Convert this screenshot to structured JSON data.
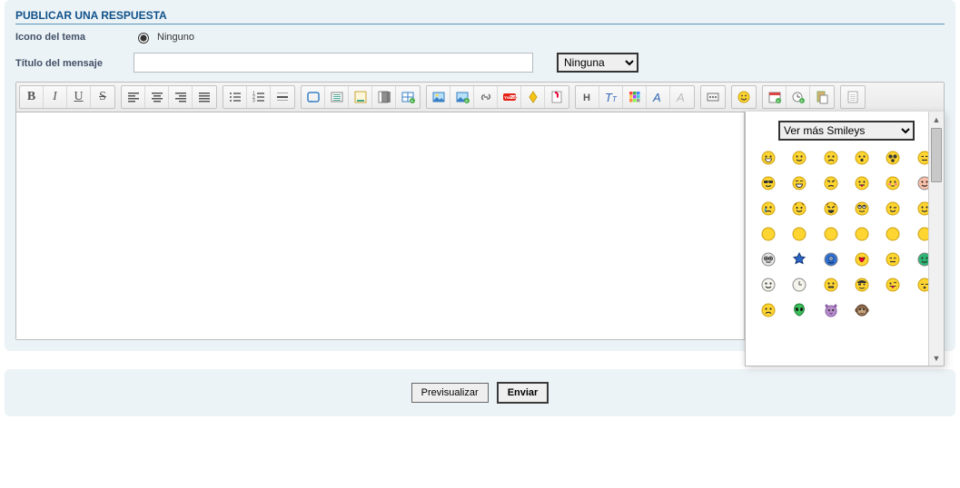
{
  "header": {
    "title": "PUBLICAR UNA RESPUESTA"
  },
  "iconRow": {
    "label": "Icono del tema",
    "option": "Ninguno"
  },
  "titleRow": {
    "label": "Título del mensaje",
    "value": "",
    "selectValue": "Ninguna"
  },
  "toolbar": {
    "groups": [
      {
        "name": "format",
        "items": [
          {
            "id": "bold",
            "label": "B",
            "glyph": "b"
          },
          {
            "id": "italic",
            "label": "I",
            "glyph": "i"
          },
          {
            "id": "underline",
            "label": "U",
            "glyph": "u"
          },
          {
            "id": "strike",
            "label": "S",
            "glyph": "s"
          }
        ]
      },
      {
        "name": "align",
        "items": [
          {
            "id": "align-left",
            "icon": "align-left"
          },
          {
            "id": "align-center",
            "icon": "align-center"
          },
          {
            "id": "align-right",
            "icon": "align-right"
          },
          {
            "id": "align-justify",
            "icon": "align-justify"
          }
        ]
      },
      {
        "name": "lists",
        "items": [
          {
            "id": "ul",
            "icon": "list-ul"
          },
          {
            "id": "ol",
            "icon": "list-ol"
          },
          {
            "id": "hr",
            "icon": "hr"
          }
        ]
      },
      {
        "name": "insert",
        "items": [
          {
            "id": "quote",
            "icon": "quote"
          },
          {
            "id": "code",
            "icon": "code"
          },
          {
            "id": "spoiler",
            "icon": "spoiler"
          },
          {
            "id": "hidden",
            "icon": "hidden"
          },
          {
            "id": "table",
            "icon": "table"
          }
        ]
      },
      {
        "name": "media",
        "items": [
          {
            "id": "image-host",
            "icon": "image-host"
          },
          {
            "id": "image",
            "icon": "image"
          },
          {
            "id": "link",
            "icon": "link"
          },
          {
            "id": "youtube",
            "icon": "youtube"
          },
          {
            "id": "dailymotion",
            "icon": "dm"
          },
          {
            "id": "flash",
            "icon": "flash"
          }
        ]
      },
      {
        "name": "font",
        "items": [
          {
            "id": "headers",
            "icon": "H"
          },
          {
            "id": "size",
            "icon": "size"
          },
          {
            "id": "color",
            "icon": "color"
          },
          {
            "id": "font",
            "icon": "font"
          },
          {
            "id": "remove-format",
            "icon": "eraser"
          }
        ]
      },
      {
        "name": "more",
        "items": [
          {
            "id": "more",
            "icon": "dots"
          }
        ]
      },
      {
        "name": "emoji",
        "items": [
          {
            "id": "emoji",
            "icon": "smiley"
          }
        ]
      },
      {
        "name": "extra",
        "items": [
          {
            "id": "date",
            "icon": "calendar"
          },
          {
            "id": "time",
            "icon": "clock"
          },
          {
            "id": "paste",
            "icon": "paste"
          }
        ]
      },
      {
        "name": "mode",
        "items": [
          {
            "id": "switch-mode",
            "icon": "page"
          }
        ]
      }
    ]
  },
  "textarea": {
    "value": ""
  },
  "smileyPanel": {
    "selectLabel": "Ver más Smileys",
    "icons": [
      {
        "id": "grin",
        "bg": "#FFD531",
        "face": "grin"
      },
      {
        "id": "smile",
        "bg": "#FFD531",
        "face": "smile"
      },
      {
        "id": "sad",
        "bg": "#FFD531",
        "face": "sad"
      },
      {
        "id": "surprised",
        "bg": "#FFD531",
        "face": "o"
      },
      {
        "id": "shocked",
        "bg": "#FFD531",
        "face": "shock"
      },
      {
        "id": "meh",
        "bg": "#FFD531",
        "face": "meh"
      },
      {
        "id": "cool",
        "bg": "#FFD531",
        "face": "cool"
      },
      {
        "id": "laugh",
        "bg": "#FFD531",
        "face": "laugh"
      },
      {
        "id": "mad",
        "bg": "#FFD531",
        "face": "mad"
      },
      {
        "id": "razz",
        "bg": "#FFD531",
        "face": "razz"
      },
      {
        "id": "blush",
        "bg": "#FFD531",
        "face": "blush"
      },
      {
        "id": "embarass",
        "bg": "#F9BFA8",
        "face": "smile"
      },
      {
        "id": "cry",
        "bg": "#FFD531",
        "face": "cry"
      },
      {
        "id": "evil",
        "bg": "#FFD531",
        "face": "evil"
      },
      {
        "id": "twisted",
        "bg": "#FFD531",
        "face": "twist"
      },
      {
        "id": "roll",
        "bg": "#FFD531",
        "face": "roll"
      },
      {
        "id": "wink",
        "bg": "#FFD531",
        "face": "wink"
      },
      {
        "id": "excl",
        "bg": "#FFD531",
        "face": "smile"
      },
      {
        "id": "y1",
        "bg": "#FFD531",
        "face": "plain"
      },
      {
        "id": "y2",
        "bg": "#FFD531",
        "face": "plain"
      },
      {
        "id": "y3",
        "bg": "#FFD531",
        "face": "plain"
      },
      {
        "id": "y4",
        "bg": "#FFD531",
        "face": "plain"
      },
      {
        "id": "y5",
        "bg": "#FFD531",
        "face": "plain"
      },
      {
        "id": "y6",
        "bg": "#FFD531",
        "face": "plain"
      },
      {
        "id": "geek",
        "bg": "#E7E7E7",
        "face": "geek"
      },
      {
        "id": "star",
        "bg": "none",
        "shape": "star",
        "fill": "#2C65C4"
      },
      {
        "id": "cyclops",
        "bg": "#2F6FD0",
        "face": "cyc"
      },
      {
        "id": "heart",
        "bg": "#FFD531",
        "face": "heart"
      },
      {
        "id": "neutral",
        "bg": "#FFD531",
        "face": "meh"
      },
      {
        "id": "green1",
        "bg": "#2BB673",
        "face": "smile"
      },
      {
        "id": "pale",
        "bg": "#F4F4EC",
        "face": "smile"
      },
      {
        "id": "clock",
        "bg": "#F4F4EC",
        "face": "clock"
      },
      {
        "id": "silent",
        "bg": "#FFD531",
        "face": "x"
      },
      {
        "id": "pirate",
        "bg": "#FFD531",
        "face": "pirate"
      },
      {
        "id": "tongue",
        "bg": "#FFD531",
        "face": "tongue"
      },
      {
        "id": "sleep",
        "bg": "#FFD531",
        "face": "sleep"
      },
      {
        "id": "sad2",
        "bg": "#FFD531",
        "face": "sad"
      },
      {
        "id": "alien",
        "bg": "#3BBF5A",
        "face": "alien"
      },
      {
        "id": "cat",
        "bg": "#B78CCB",
        "face": "cat"
      },
      {
        "id": "monkey",
        "bg": "#8F6B4E",
        "face": "monkey"
      }
    ]
  },
  "buttons": {
    "preview": "Previsualizar",
    "submit": "Enviar"
  },
  "colors": {
    "link": "#105289",
    "panel": "#ECF3F7"
  }
}
